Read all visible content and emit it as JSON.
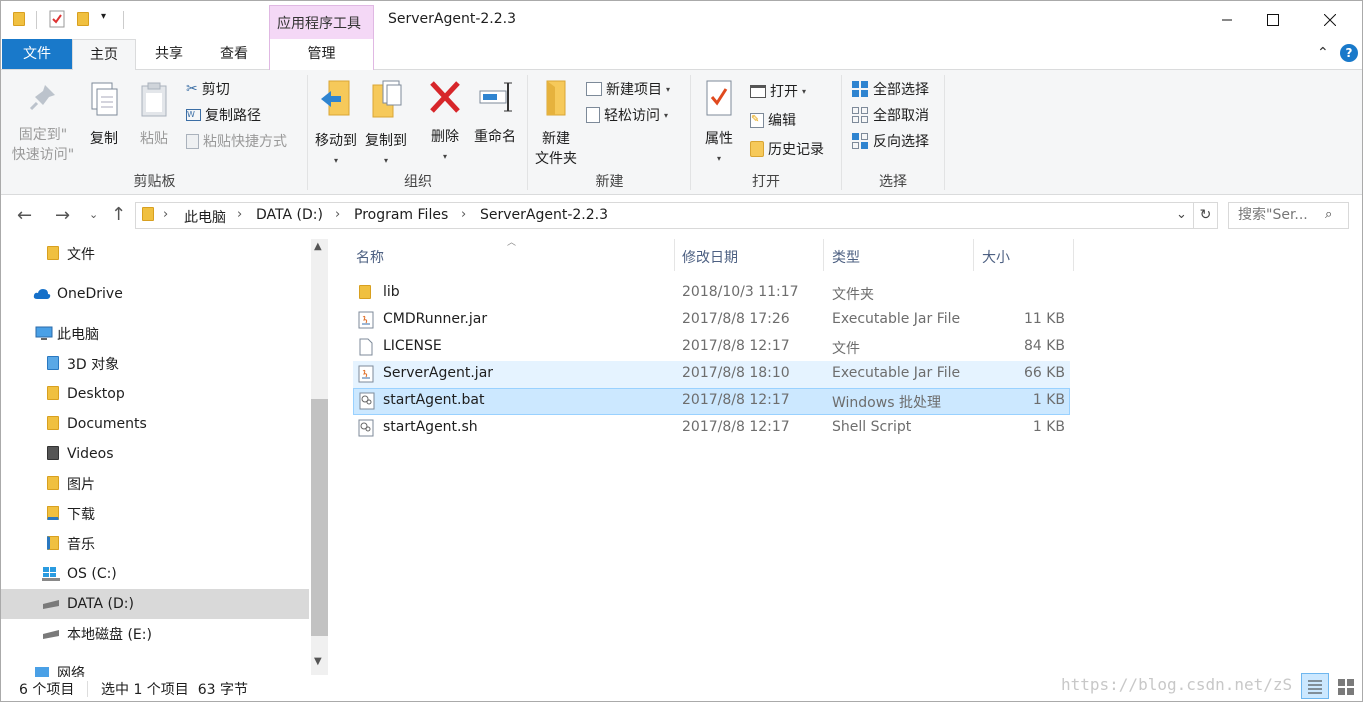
{
  "window": {
    "title": "ServerAgent-2.2.3",
    "context_group": "应用程序工具"
  },
  "tabs": {
    "file": "文件",
    "home": "主页",
    "share": "共享",
    "view": "查看",
    "manage": "管理"
  },
  "ribbon": {
    "clipboard": {
      "label": "剪贴板",
      "pin": "固定到\"快速访问\"",
      "pin_line1": "固定到\"",
      "pin_line2": "快速访问\"",
      "copy": "复制",
      "paste": "粘贴",
      "cut": "剪切",
      "copy_path": "复制路径",
      "paste_shortcut": "粘贴快捷方式"
    },
    "organize": {
      "label": "组织",
      "move_to": "移动到",
      "copy_to": "复制到",
      "delete": "删除",
      "rename": "重命名"
    },
    "new": {
      "label": "新建",
      "new_folder_line1": "新建",
      "new_folder_line2": "文件夹",
      "new_item": "新建项目",
      "easy_access": "轻松访问"
    },
    "open": {
      "label": "打开",
      "properties": "属性",
      "open": "打开",
      "edit": "编辑",
      "history": "历史记录"
    },
    "select": {
      "label": "选择",
      "select_all": "全部选择",
      "select_none": "全部取消",
      "invert": "反向选择"
    }
  },
  "address": {
    "crumbs": [
      "此电脑",
      "DATA (D:)",
      "Program Files",
      "ServerAgent-2.2.3"
    ],
    "search_placeholder": "搜索\"Ser..."
  },
  "nav": {
    "items": [
      {
        "label": "文件",
        "icon": "folder-icon"
      },
      {
        "label": "OneDrive",
        "icon": "cloud-icon"
      },
      {
        "label": "此电脑",
        "icon": "computer-icon"
      },
      {
        "label": "3D 对象",
        "icon": "3d-objects-icon"
      },
      {
        "label": "Desktop",
        "icon": "desktop-folder-icon"
      },
      {
        "label": "Documents",
        "icon": "documents-folder-icon"
      },
      {
        "label": "Videos",
        "icon": "videos-folder-icon"
      },
      {
        "label": "图片",
        "icon": "pictures-folder-icon"
      },
      {
        "label": "下载",
        "icon": "downloads-folder-icon"
      },
      {
        "label": "音乐",
        "icon": "music-folder-icon"
      },
      {
        "label": "OS (C:)",
        "icon": "windows-drive-icon"
      },
      {
        "label": "DATA (D:)",
        "icon": "drive-icon"
      },
      {
        "label": "本地磁盘 (E:)",
        "icon": "drive-icon"
      },
      {
        "label": "网络",
        "icon": "network-icon"
      }
    ]
  },
  "columns": {
    "name": "名称",
    "modified": "修改日期",
    "type": "类型",
    "size": "大小"
  },
  "files": [
    {
      "name": "lib",
      "modified": "2018/10/3 11:17",
      "type": "文件夹",
      "size": "",
      "icon": "folder-icon"
    },
    {
      "name": "CMDRunner.jar",
      "modified": "2017/8/8 17:26",
      "type": "Executable Jar File",
      "size": "11 KB",
      "icon": "jar-file-icon"
    },
    {
      "name": "LICENSE",
      "modified": "2017/8/8 12:17",
      "type": "文件",
      "size": "84 KB",
      "icon": "blank-file-icon"
    },
    {
      "name": "ServerAgent.jar",
      "modified": "2017/8/8 18:10",
      "type": "Executable Jar File",
      "size": "66 KB",
      "icon": "jar-file-icon"
    },
    {
      "name": "startAgent.bat",
      "modified": "2017/8/8 12:17",
      "type": "Windows 批处理",
      "size": "1 KB",
      "icon": "batch-file-icon"
    },
    {
      "name": "startAgent.sh",
      "modified": "2017/8/8 12:17",
      "type": "Shell Script",
      "size": "1 KB",
      "icon": "script-file-icon"
    }
  ],
  "status": {
    "count": "6 个项目",
    "selected": "选中 1 个项目  63 字节"
  },
  "watermark": "https://blog.csdn.net/zS",
  "colors": {
    "file_tab": "#1979ca",
    "context_tab": "#f4d8f6",
    "selected_row": "#cce8ff",
    "hover_row": "#e5f3ff"
  }
}
